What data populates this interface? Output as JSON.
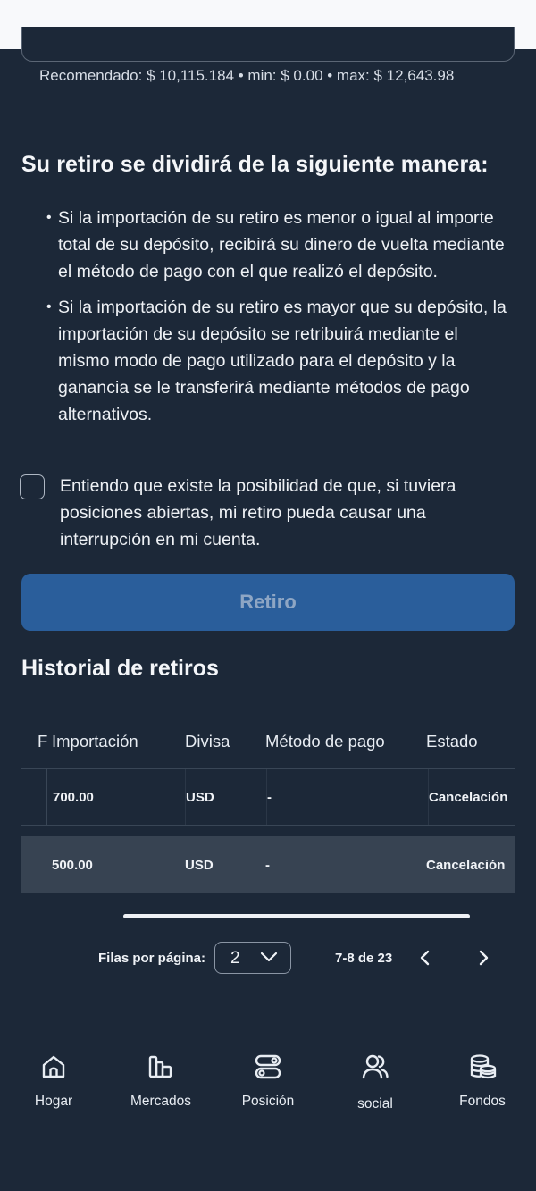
{
  "amount_hint": "Recomendado: $ 10,115.184 • min: $ 0.00 • max: $ 12,643.98",
  "split_section": {
    "title": "Su retiro se dividirá de la siguiente manera:",
    "bullets": [
      "Si la importación de su retiro es menor o igual al importe total de su depósito, recibirá su dinero de vuelta mediante el método de pago con el que realizó el depósito.",
      "Si la importación de su retiro es mayor que su depósito, la importación de su depósito se retribuirá mediante el mismo modo de pago utilizado para el depósito y la ganancia se le transferirá mediante métodos de pago alternativos."
    ]
  },
  "acknowledge": {
    "label": "Entiendo que existe la posibilidad de que, si tuviera posiciones abiertas, mi retiro pueda causar una interrupción en mi cuenta.",
    "checked": false
  },
  "withdraw_button": "Retiro",
  "history": {
    "title": "Historial de retiros",
    "columns": [
      "F",
      "Importación",
      "Divisa",
      "Método de pago",
      "Estado"
    ],
    "rows": [
      {
        "amount": "700.00",
        "currency": "USD",
        "method": "-",
        "status": "Cancelación"
      },
      {
        "amount": "500.00",
        "currency": "USD",
        "method": "-",
        "status": "Cancelación"
      }
    ]
  },
  "pagination": {
    "rows_label": "Filas por página:",
    "rows_per_page": "2",
    "range": "7-8 de 23"
  },
  "bottom_nav": [
    {
      "label": "Hogar",
      "icon": "home-icon"
    },
    {
      "label": "Mercados",
      "icon": "bar-chart-icon"
    },
    {
      "label": "Posición",
      "icon": "toggles-icon"
    },
    {
      "label": "social",
      "icon": "users-icon"
    },
    {
      "label": "Fondos",
      "icon": "coins-icon"
    }
  ],
  "colors": {
    "background": "#1c2838",
    "primary_button": "#2a5e9b",
    "row_highlight": "#374352"
  }
}
